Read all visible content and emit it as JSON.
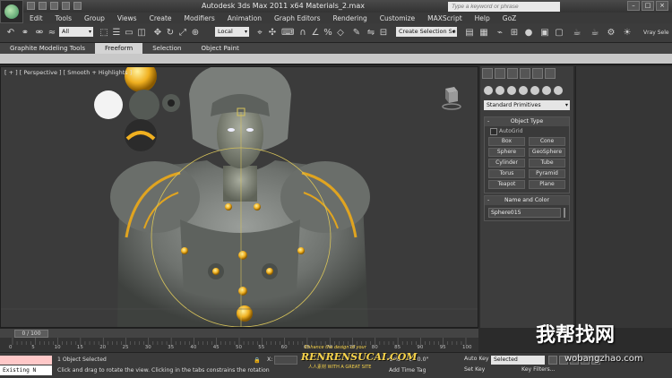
{
  "title": "Autodesk 3ds Max  2011 x64     Materials_2.max",
  "search_placeholder": "Type a keyword or phrase",
  "menu": [
    "Edit",
    "Tools",
    "Group",
    "Views",
    "Create",
    "Modifiers",
    "Animation",
    "Graph Editors",
    "Rendering",
    "Customize",
    "MAXScript",
    "Help",
    "GoZ"
  ],
  "toolbar": {
    "filter": "All",
    "refcoord": "Local",
    "named_selection": "Create Selection Se",
    "vray": "Vray Sele"
  },
  "ribbon_tabs": [
    "Graphite Modeling Tools",
    "Freeform",
    "Selection",
    "Object Paint"
  ],
  "ribbon_active": "Freeform",
  "viewport_label": "[ + ] [ Perspective ] [ Smooth + Highlights ]",
  "command_panel": {
    "category": "Standard Primitives",
    "object_type_title": "Object Type",
    "autogrid": "AutoGrid",
    "objects": [
      "Box",
      "Cone",
      "Sphere",
      "GeoSphere",
      "Cylinder",
      "Tube",
      "Torus",
      "Pyramid",
      "Teapot",
      "Plane"
    ],
    "name_color_title": "Name and Color",
    "object_name": "Sphere015",
    "object_color": "#5a22c9"
  },
  "timeline": {
    "frame": "0 / 100",
    "ticks": [
      "0",
      "5",
      "10",
      "15",
      "20",
      "25",
      "30",
      "35",
      "40",
      "45",
      "50",
      "55",
      "60",
      "65",
      "70",
      "75",
      "80",
      "85",
      "90",
      "95",
      "100"
    ]
  },
  "status": {
    "maxscript": "Existing N",
    "selection": "1 Object Selected",
    "prompt": "Click and drag to rotate the view.  Clicking in the tabs constrains the rotation",
    "x": "X:",
    "grid": "Grid = 0'10.0\"",
    "add_time_tag": "Add Time Tag",
    "auto_key": "Auto Key",
    "set_key": "Set Key",
    "selected": "Selected",
    "key_filters": "Key Filters..."
  },
  "watermarks": {
    "logo_tag": "Enhance the design of your",
    "logo_name": "RENRENSUCAI.COM",
    "logo_sub": "人人素材  WITH A GREAT SITE",
    "cn": "我帮找网",
    "url": "wobangzhao.com"
  }
}
